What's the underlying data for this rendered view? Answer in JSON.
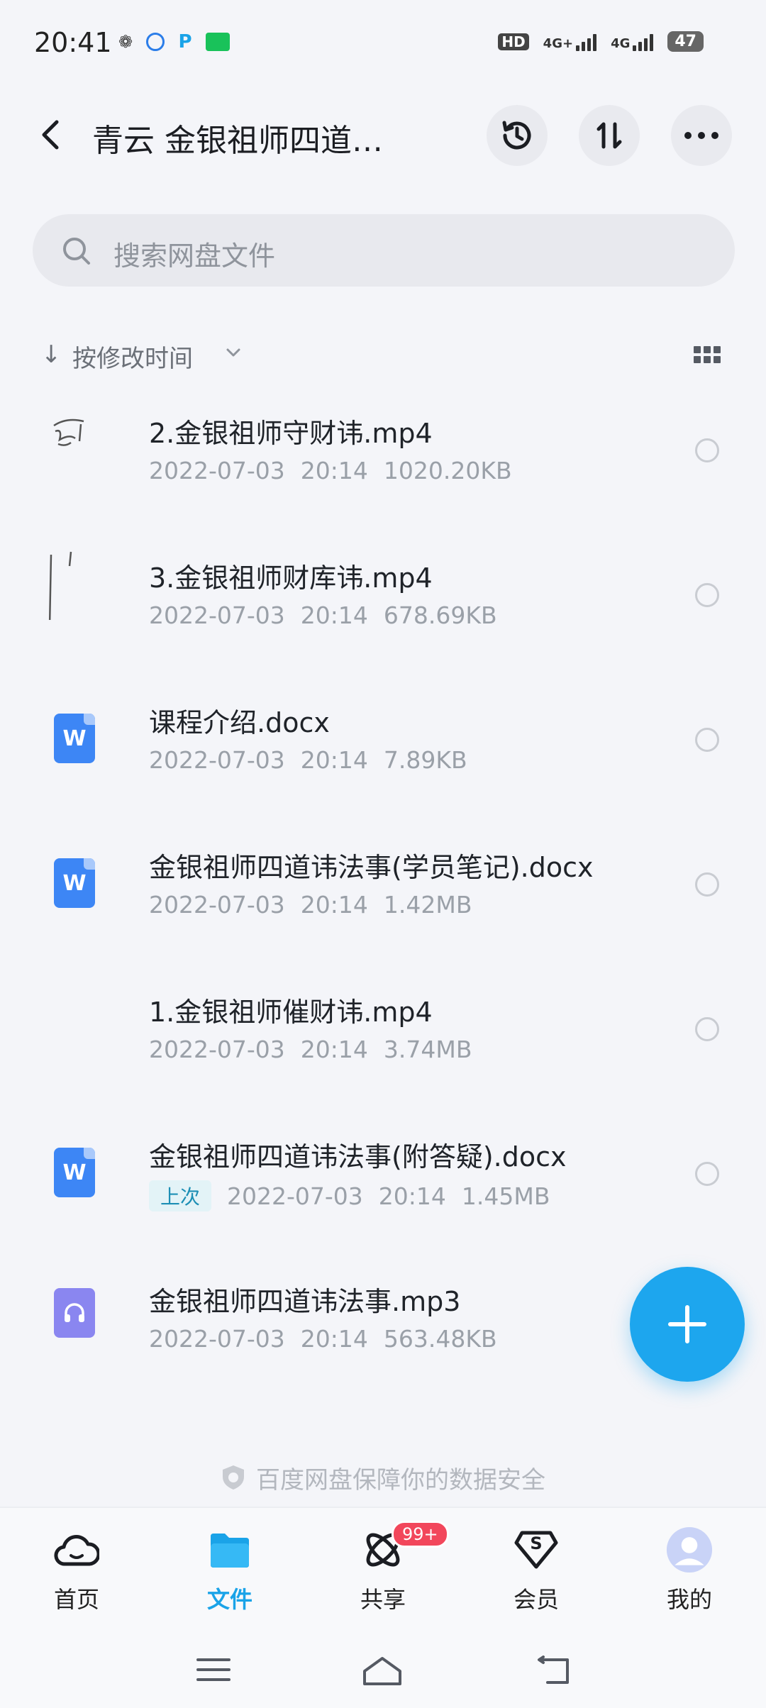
{
  "status_bar": {
    "time": "20:41",
    "hd_label": "HD",
    "net1": "4G+",
    "net2": "4G",
    "battery": "47"
  },
  "header": {
    "title": "青云 金银祖师四道…",
    "history_icon": "history-icon",
    "sort_icon": "sort-icon",
    "more_icon": "more-icon"
  },
  "search": {
    "placeholder": "搜索网盘文件"
  },
  "sort": {
    "arrow": "↓",
    "label": "按修改时间"
  },
  "files": [
    {
      "name": "2.金银祖师守财讳.mp4",
      "date": "2022-07-03",
      "time": "20:14",
      "size": "1020.20KB",
      "icon": "video-thumb"
    },
    {
      "name": "3.金银祖师财库讳.mp4",
      "date": "2022-07-03",
      "time": "20:14",
      "size": "678.69KB",
      "icon": "video-thumb"
    },
    {
      "name": "课程介绍.docx",
      "date": "2022-07-03",
      "time": "20:14",
      "size": "7.89KB",
      "icon": "word-icon"
    },
    {
      "name": "金银祖师四道讳法事(学员笔记).docx",
      "date": "2022-07-03",
      "time": "20:14",
      "size": "1.42MB",
      "icon": "word-icon"
    },
    {
      "name": "1.金银祖师催财讳.mp4",
      "date": "2022-07-03",
      "time": "20:14",
      "size": "3.74MB",
      "icon": "video-thumb"
    },
    {
      "name": "金银祖师四道讳法事(附答疑).docx",
      "tag": "上次",
      "date": "2022-07-03",
      "time": "20:14",
      "size": "1.45MB",
      "icon": "word-icon"
    },
    {
      "name": "金银祖师四道讳法事.mp3",
      "date": "2022-07-03",
      "time": "20:14",
      "size": "563.48KB",
      "icon": "audio-icon"
    }
  ],
  "doc_icon_letter": "W",
  "safety_note": "百度网盘保障你的数据安全",
  "nav": {
    "home": "首页",
    "files": "文件",
    "share": "共享",
    "share_badge": "99+",
    "vip": "会员",
    "vip_symbol": "S",
    "mine": "我的"
  },
  "colors": {
    "accent": "#1da6ee",
    "word": "#3d86f5",
    "audio": "#8a86f0",
    "badge": "#f2475b"
  }
}
